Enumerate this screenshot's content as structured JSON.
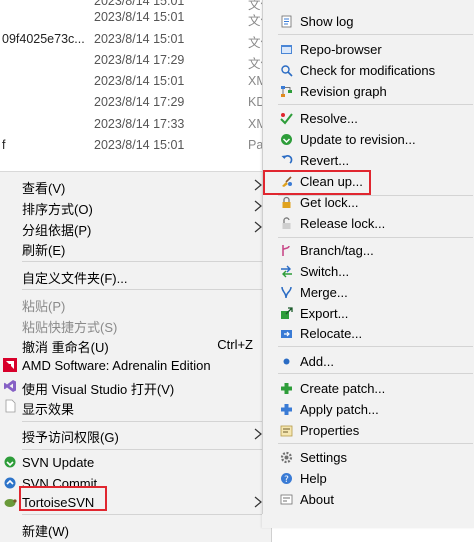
{
  "explorer_rows": [
    {
      "name": "",
      "date": "2023/8/14 15:01",
      "type": "文件"
    },
    {
      "name": "",
      "date": "2023/8/14 15:01",
      "type": "文件"
    },
    {
      "name": "09f4025e73c...",
      "date": "2023/8/14 15:01",
      "type": "文件"
    },
    {
      "name": "",
      "date": "2023/8/14 17:29",
      "type": "文件"
    },
    {
      "name": "",
      "date": "2023/8/14 15:01",
      "type": "XMI"
    },
    {
      "name": "",
      "date": "2023/8/14 17:29",
      "type": "KDS"
    },
    {
      "name": "",
      "date": "2023/8/14 17:33",
      "type": "XMI"
    },
    {
      "name": "f",
      "date": "2023/8/14 15:01",
      "type": "Pac"
    }
  ],
  "context_menu": {
    "view": "查看(V)",
    "sort_by": "排序方式(O)",
    "group_by": "分组依据(P)",
    "refresh": "刷新(E)",
    "customize_folder": "自定义文件夹(F)...",
    "paste": "粘贴(P)",
    "paste_shortcut": "粘贴快捷方式(S)",
    "undo_rename": "撤消 重命名(U)",
    "undo_shortcut": "Ctrl+Z",
    "amd_software": "AMD Software: Adrenalin Edition",
    "open_vs": "使用 Visual Studio 打开(V)",
    "show_effects": "显示效果",
    "grant_access": "授予访问权限(G)",
    "svn_update": "SVN Update",
    "svn_commit": "SVN Commit...",
    "tortoisesvn": "TortoiseSVN",
    "new": "新建(W)"
  },
  "svn_submenu": {
    "items": [
      "Show log",
      "Repo-browser",
      "Check for modifications",
      "Revision graph",
      "Resolve...",
      "Update to revision...",
      "Revert...",
      "Clean up...",
      "Get lock...",
      "Release lock...",
      "Branch/tag...",
      "Switch...",
      "Merge...",
      "Export...",
      "Relocate...",
      "Add...",
      "Create patch...",
      "Apply patch...",
      "Properties",
      "Settings",
      "Help",
      "About"
    ]
  },
  "colors": {
    "highlight_border": "#e0262f",
    "menu_bg": "#f2f2f2"
  }
}
